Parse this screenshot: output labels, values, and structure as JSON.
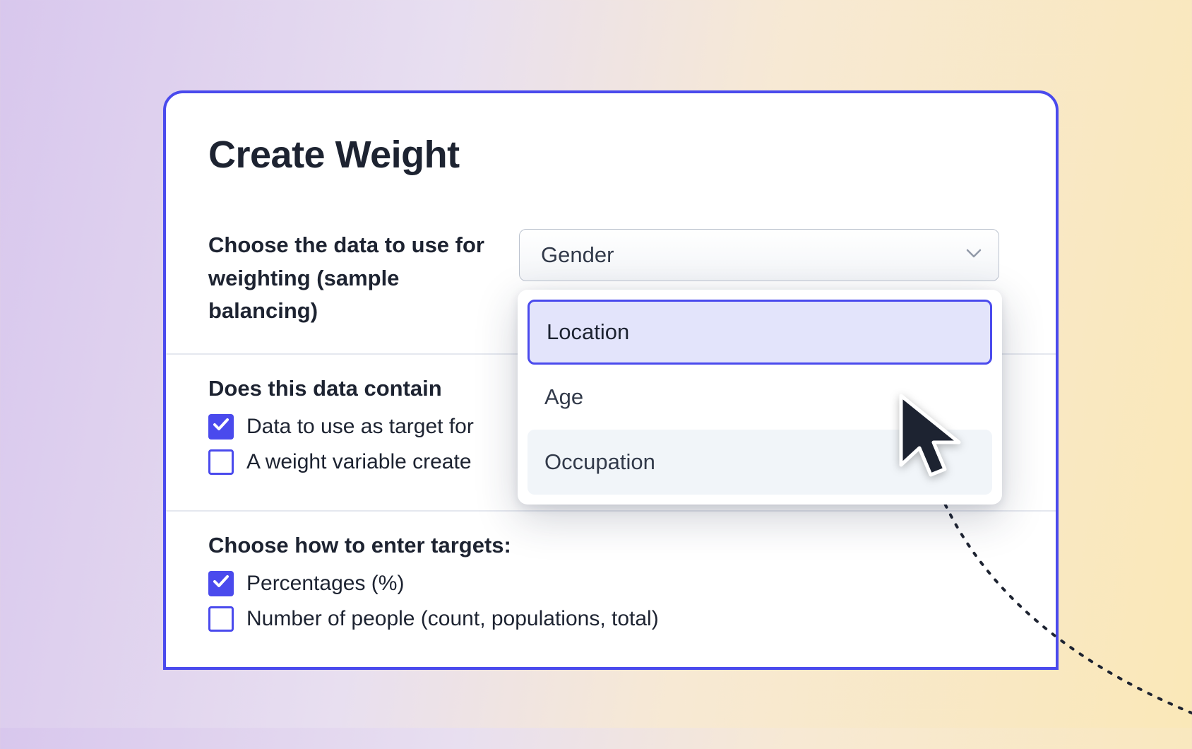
{
  "panel": {
    "title": "Create Weight"
  },
  "field1": {
    "label": "Choose the data to use for weighting (sample balancing)",
    "selected": "Gender",
    "options": {
      "location": "Location",
      "age": "Age",
      "occupation": "Occupation"
    }
  },
  "section2": {
    "heading": "Does this data contain",
    "checkbox1": {
      "label": "Data to use as target for",
      "checked": true
    },
    "checkbox2": {
      "label": "A weight variable create",
      "checked": false
    }
  },
  "section3": {
    "heading": "Choose how to enter targets:",
    "checkbox1": {
      "label": "Percentages (%)",
      "checked": true
    },
    "checkbox2": {
      "label": "Number of people (count, populations, total)",
      "checked": false
    }
  }
}
